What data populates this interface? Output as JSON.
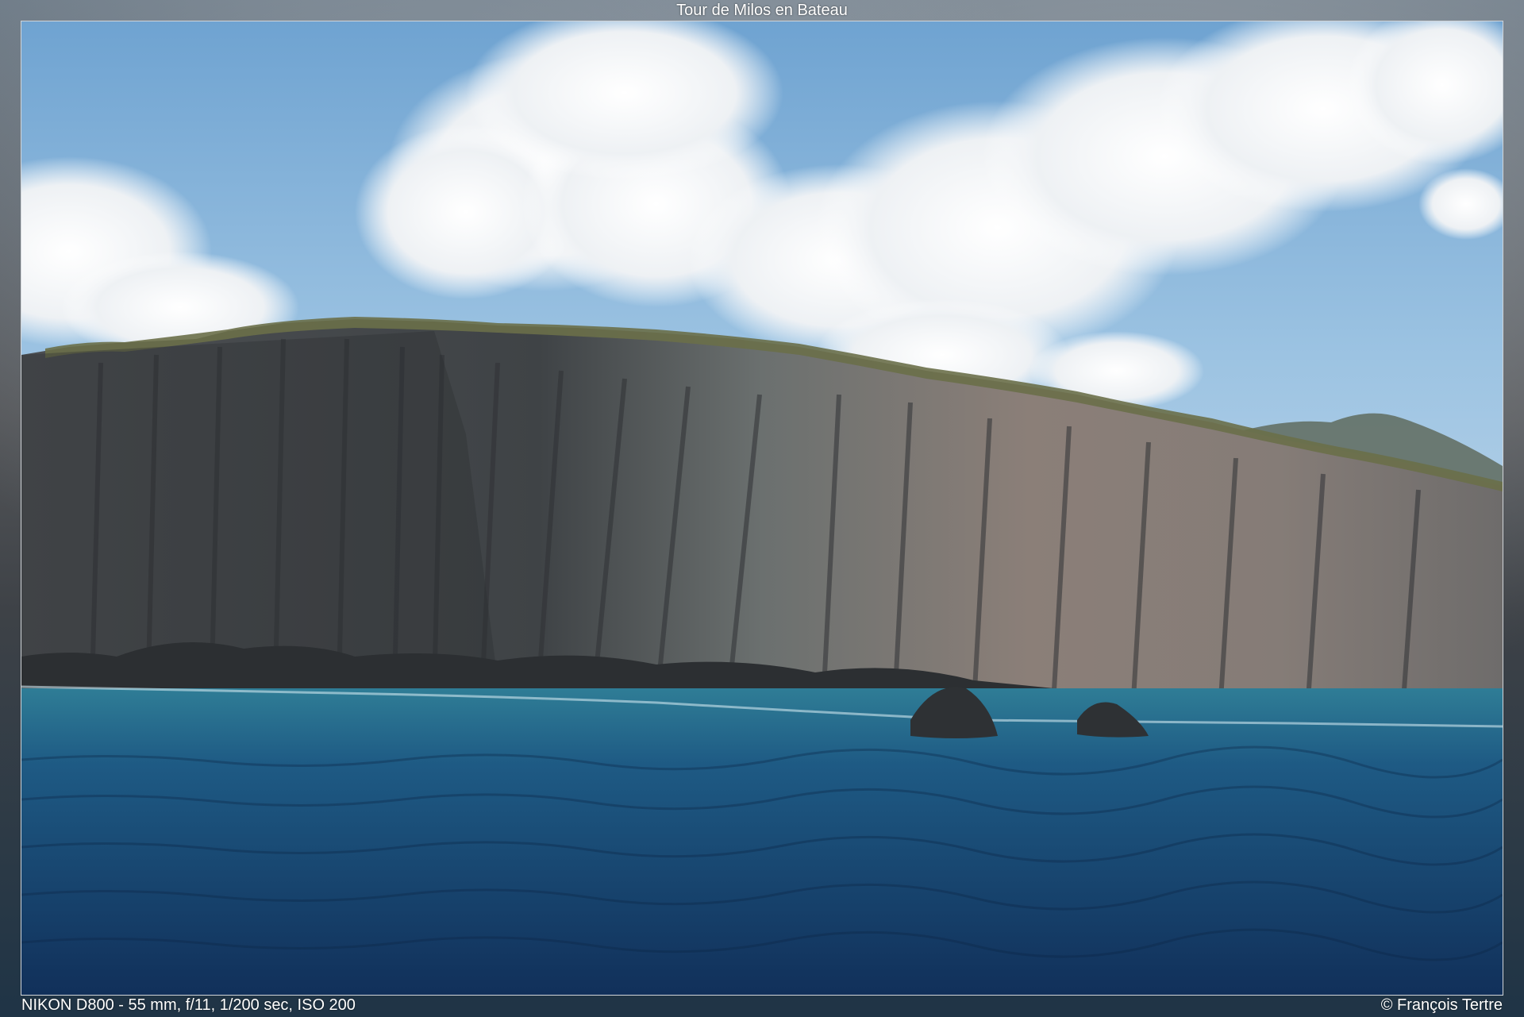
{
  "title": "Tour de Milos en Bateau",
  "exif": "NIKON D800 - 55 mm, f/11, 1/200 sec, ISO 200",
  "copyright": "© François Tertre",
  "photo": {
    "subject": "coastal-cliff-photo",
    "colors": {
      "sky": "#8fb8dc",
      "cloud": "#f4f6f8",
      "cliff_dark": "#4a4c4e",
      "cliff_light": "#8a8582",
      "cliff_warm": "#9a8478",
      "vegetation": "#6b7047",
      "sea_top": "#2d7590",
      "sea_bottom": "#143a66"
    }
  }
}
